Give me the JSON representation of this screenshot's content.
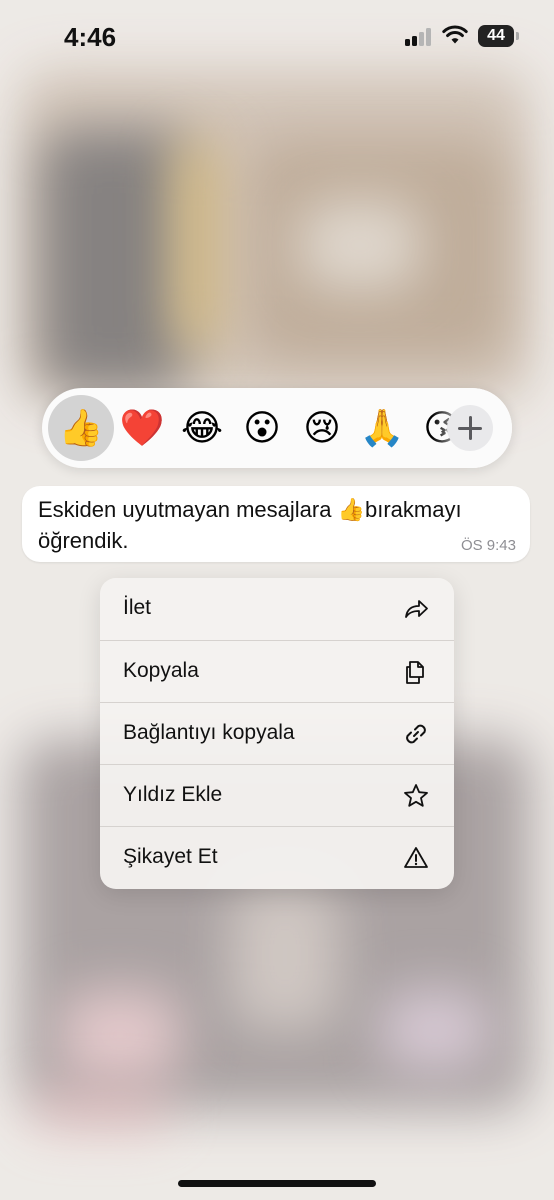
{
  "status_bar": {
    "time": "4:46",
    "battery": "44"
  },
  "reactions": {
    "selected": "👍",
    "emojis": [
      "👍",
      "❤️",
      "😂",
      "😮",
      "😢",
      "🙏",
      "😘"
    ],
    "more_icon": "plus-icon"
  },
  "message": {
    "text": "Eskiden uyutmayan mesajlara 👍bırakmayı öğrendik.",
    "time": "ÖS 9:43"
  },
  "menu": {
    "items": [
      {
        "label": "İlet",
        "icon": "forward-icon"
      },
      {
        "label": "Kopyala",
        "icon": "copy-icon"
      },
      {
        "label": "Bağlantıyı kopyala",
        "icon": "link-icon"
      },
      {
        "label": "Yıldız Ekle",
        "icon": "star-icon"
      },
      {
        "label": "Şikayet Et",
        "icon": "warning-icon"
      }
    ]
  }
}
